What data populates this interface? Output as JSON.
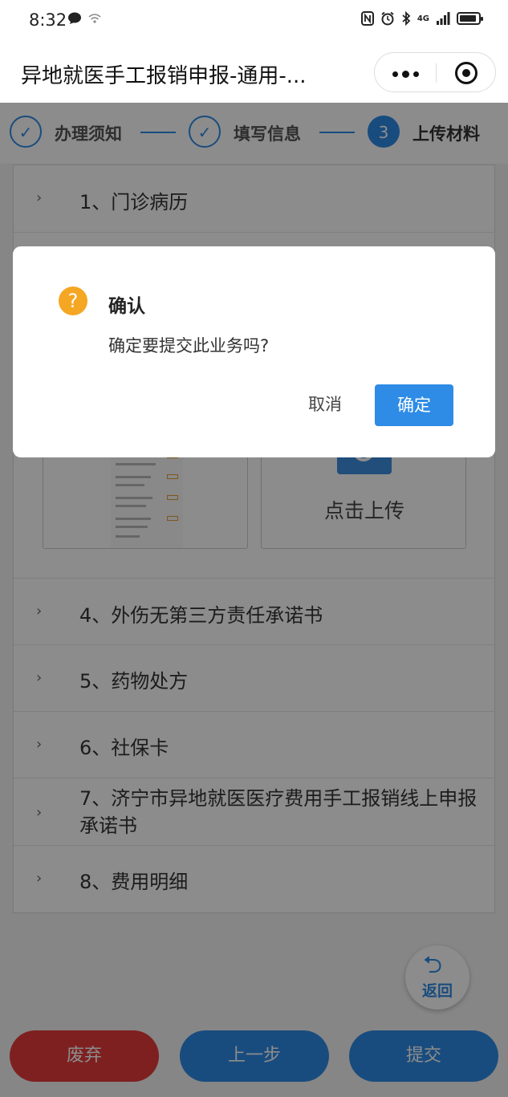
{
  "status": {
    "time": "8:32",
    "network": "4G"
  },
  "header": {
    "title": "异地就医手工报销申报-通用-..."
  },
  "stepper": {
    "steps": [
      {
        "number": "✓",
        "label": "办理须知"
      },
      {
        "number": "✓",
        "label": "填写信息"
      },
      {
        "number": "3",
        "label": "上传材料"
      }
    ]
  },
  "materials": {
    "items": [
      {
        "label": "1、门诊病历"
      },
      {
        "label": "4、外伤无第三方责任承诺书"
      },
      {
        "label": "5、药物处方"
      },
      {
        "label": "6、社保卡"
      },
      {
        "label": "7、济宁市异地就医医疗费用手工报销线上申报承诺书"
      },
      {
        "label": "8、费用明细"
      }
    ],
    "upload_label": "点击上传"
  },
  "back_button": {
    "label": "返回"
  },
  "footer": {
    "discard_label": "废弃",
    "prev_label": "上一步",
    "submit_label": "提交"
  },
  "dialog": {
    "icon": "?",
    "title": "确认",
    "message": "确定要提交此业务吗?",
    "cancel_label": "取消",
    "confirm_label": "确定"
  },
  "colors": {
    "primary": "#2e8be6",
    "danger": "#e63b3b",
    "warning": "#f5a623"
  }
}
